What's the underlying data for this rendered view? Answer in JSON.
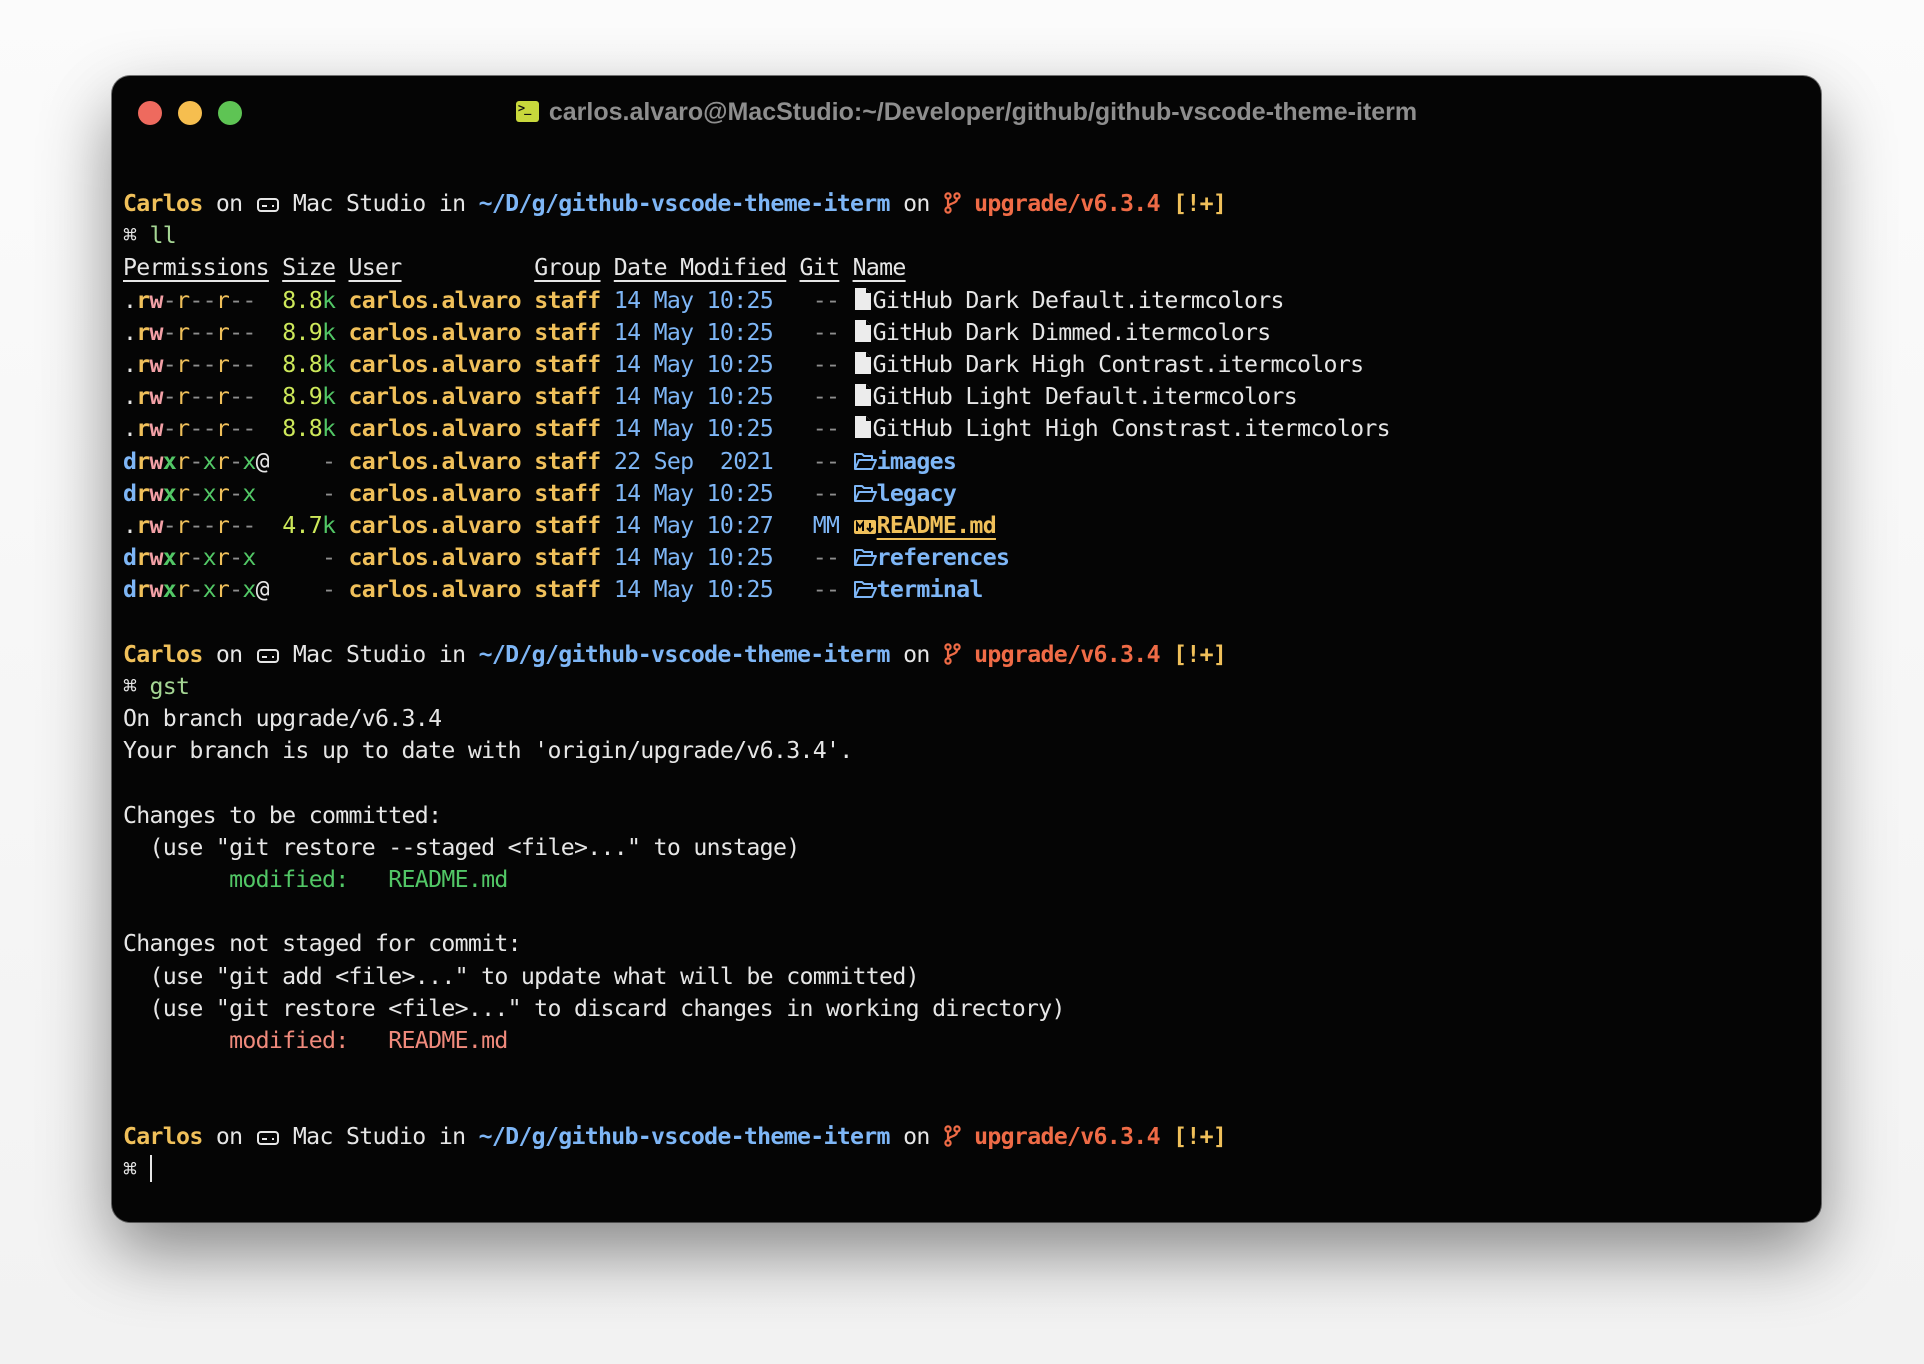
{
  "window": {
    "title": "carlos.alvaro@MacStudio:~/Developer/github/github-vscode-theme-iterm",
    "buttons": [
      "close",
      "minimize",
      "maximize"
    ]
  },
  "colors": {
    "user_yellow": "#f0c05a",
    "path_blue": "#7eb6f6",
    "branch_orange": "#ef6b46",
    "staged_green": "#52c766",
    "unstaged_red": "#f08a7c",
    "background": "#050505"
  },
  "prompt": {
    "user": "Carlos",
    "on": "on",
    "host": "Mac Studio",
    "in": "in",
    "path": "~/D/g/github-vscode-theme-iterm",
    "on2": "on",
    "branch": "upgrade/v6.3.4",
    "status": "[!+]",
    "symbol": "⌘"
  },
  "commands": [
    "ll",
    "gst",
    ""
  ],
  "listing": {
    "headers": [
      "Permissions",
      "Size",
      "User",
      "Group",
      "Date Modified",
      "Git",
      "Name"
    ],
    "rows": [
      {
        "type": "file",
        "perm": ".rw-r--r--",
        "size": "8.8",
        "unit": "k",
        "user": "carlos.alvaro",
        "group": "staff",
        "date": "14 May 10:25",
        "git": "--",
        "name": "GitHub Dark Default.itermcolors",
        "icon": "file-icon"
      },
      {
        "type": "file",
        "perm": ".rw-r--r--",
        "size": "8.9",
        "unit": "k",
        "user": "carlos.alvaro",
        "group": "staff",
        "date": "14 May 10:25",
        "git": "--",
        "name": "GitHub Dark Dimmed.itermcolors",
        "icon": "file-icon"
      },
      {
        "type": "file",
        "perm": ".rw-r--r--",
        "size": "8.8",
        "unit": "k",
        "user": "carlos.alvaro",
        "group": "staff",
        "date": "14 May 10:25",
        "git": "--",
        "name": "GitHub Dark High Contrast.itermcolors",
        "icon": "file-icon"
      },
      {
        "type": "file",
        "perm": ".rw-r--r--",
        "size": "8.9",
        "unit": "k",
        "user": "carlos.alvaro",
        "group": "staff",
        "date": "14 May 10:25",
        "git": "--",
        "name": "GitHub Light Default.itermcolors",
        "icon": "file-icon"
      },
      {
        "type": "file",
        "perm": ".rw-r--r--",
        "size": "8.8",
        "unit": "k",
        "user": "carlos.alvaro",
        "group": "staff",
        "date": "14 May 10:25",
        "git": "--",
        "name": "GitHub Light High Constrast.itermcolors",
        "icon": "file-icon"
      },
      {
        "type": "dir",
        "perm": "drwxr-xr-x@",
        "size": "-",
        "unit": "",
        "user": "carlos.alvaro",
        "group": "staff",
        "date": "22 Sep  2021",
        "git": "--",
        "name": "images",
        "icon": "folder-icon"
      },
      {
        "type": "dir",
        "perm": "drwxr-xr-x",
        "size": "-",
        "unit": "",
        "user": "carlos.alvaro",
        "group": "staff",
        "date": "14 May 10:25",
        "git": "--",
        "name": "legacy",
        "icon": "folder-icon"
      },
      {
        "type": "md",
        "perm": ".rw-r--r--",
        "size": "4.7",
        "unit": "k",
        "user": "carlos.alvaro",
        "group": "staff",
        "date": "14 May 10:27",
        "git": "MM",
        "name": "README.md",
        "icon": "markdown-icon"
      },
      {
        "type": "dir",
        "perm": "drwxr-xr-x",
        "size": "-",
        "unit": "",
        "user": "carlos.alvaro",
        "group": "staff",
        "date": "14 May 10:25",
        "git": "--",
        "name": "references",
        "icon": "folder-icon"
      },
      {
        "type": "dir",
        "perm": "drwxr-xr-x@",
        "size": "-",
        "unit": "",
        "user": "carlos.alvaro",
        "group": "staff",
        "date": "14 May 10:25",
        "git": "--",
        "name": "terminal",
        "icon": "folder-icon"
      }
    ]
  },
  "git_status": {
    "branch_line": "On branch upgrade/v6.3.4",
    "uptodate_line": "Your branch is up to date with 'origin/upgrade/v6.3.4'.",
    "staged_header": "Changes to be committed:",
    "staged_hint": "  (use \"git restore --staged <file>...\" to unstage)",
    "staged_label": "        modified:   ",
    "staged_file": "README.md",
    "unstaged_header": "Changes not staged for commit:",
    "unstaged_hint1": "  (use \"git add <file>...\" to update what will be committed)",
    "unstaged_hint2": "  (use \"git restore <file>...\" to discard changes in working directory)",
    "unstaged_label": "        modified:   ",
    "unstaged_file": "README.md"
  }
}
